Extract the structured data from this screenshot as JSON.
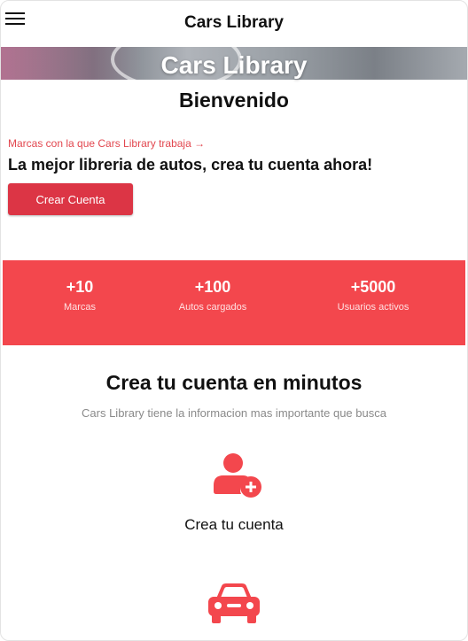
{
  "header": {
    "title": "Cars Library",
    "menu_icon": "hamburger-menu-icon"
  },
  "hero": {
    "title": "Cars Library"
  },
  "welcome": "Bienvenido",
  "intro": {
    "brand_link": "Marcas con la que Cars Library trabaja →",
    "headline": "La mejor libreria de autos, crea tu cuenta ahora!",
    "cta_label": "Crear Cuenta"
  },
  "stats": [
    {
      "value": "+10",
      "label": "Marcas"
    },
    {
      "value": "+100",
      "label": "Autos cargados"
    },
    {
      "value": "+5000",
      "label": "Usuarios activos"
    }
  ],
  "features": {
    "title": "Crea tu cuenta en minutos",
    "subtitle": "Cars Library tiene la informacion mas importante que busca",
    "items": [
      {
        "icon": "user-plus-icon",
        "title": "Crea tu cuenta"
      },
      {
        "icon": "car-icon",
        "title": ""
      }
    ]
  },
  "colors": {
    "accent": "#f3474d",
    "button": "#dc3545",
    "link": "#e2474f"
  }
}
